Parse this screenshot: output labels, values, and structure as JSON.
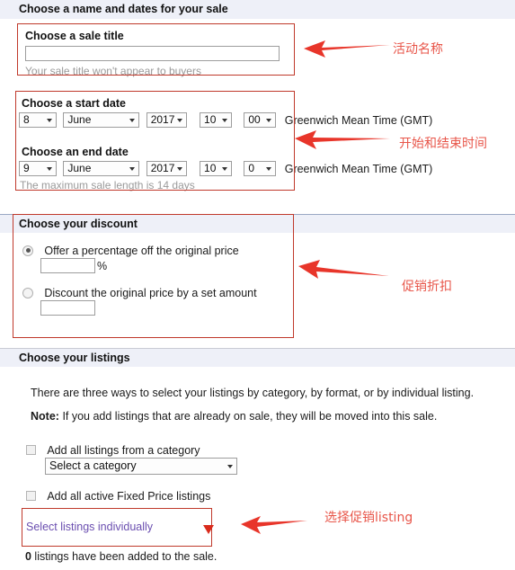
{
  "sections": {
    "name_dates": {
      "header": "Choose a name and dates for your sale",
      "sale_title_label": "Choose a sale title",
      "sale_title_value": "",
      "sale_title_hint": "Your sale title won't appear to buyers",
      "start_date_label": "Choose a start date",
      "end_date_label": "Choose an end date",
      "max_length_hint": "The maximum sale length is 14 days",
      "timezone": "Greenwich Mean Time (GMT)",
      "start": {
        "day": "8",
        "month": "June",
        "year": "2017",
        "hour": "10",
        "minute": "00"
      },
      "end": {
        "day": "9",
        "month": "June",
        "year": "2017",
        "hour": "10",
        "minute": "0"
      }
    },
    "discount": {
      "header": "Choose your discount",
      "option_percentage": "Offer a percentage off the original price",
      "percent_value": "",
      "percent_suffix": "%",
      "option_set_amount": "Discount the original price by a set amount",
      "amount_value": ""
    },
    "listings": {
      "header": "Choose your listings",
      "intro": "There are three ways to select your listings by category, by format, or by individual listing.",
      "note_bold": "Note:",
      "note_text": "If you add listings that are already on sale, they will be moved into this sale.",
      "checkbox_category_label": "Add all listings from a category",
      "category_select_value": "Select a category",
      "checkbox_fixed_price_label": "Add all active Fixed Price listings",
      "select_individually_link": "Select listings individually",
      "added_count_bold": "0",
      "added_count_text": " listings have been added to the sale."
    }
  },
  "annotations": [
    {
      "id": "title",
      "text": "活动名称"
    },
    {
      "id": "dates",
      "text": "开始和结束时间"
    },
    {
      "id": "discount",
      "text": "促销折扣"
    },
    {
      "id": "listings",
      "text": "选择促销listing"
    }
  ],
  "colors": {
    "band_bg": "#eef0f8",
    "annotation_red": "#e8564a",
    "box_red": "#c0392b",
    "link_purple": "#6b4fb0"
  }
}
